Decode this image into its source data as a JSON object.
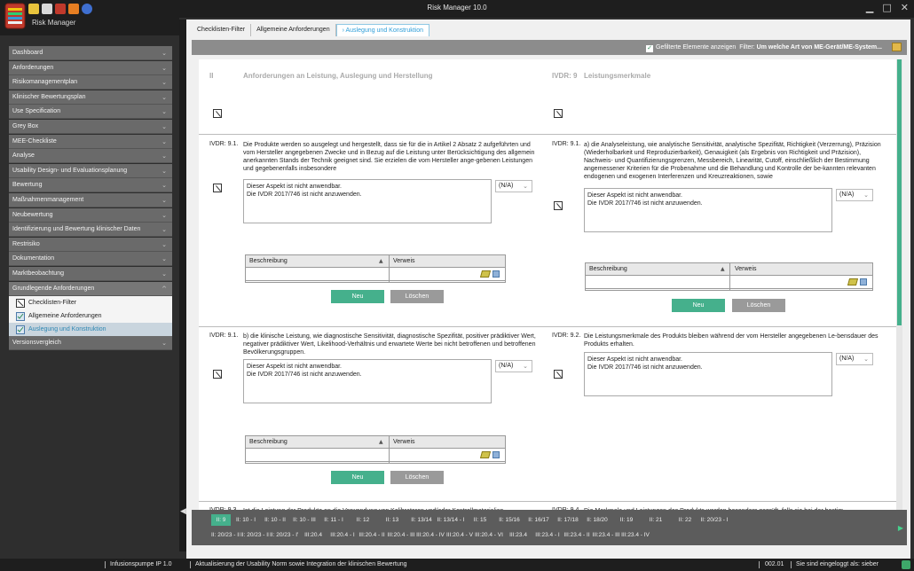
{
  "window": {
    "title": "Risk Manager 10.0",
    "minimize": "▁",
    "maximize": "□",
    "close": "✕"
  },
  "logo": {
    "label": "Risk Manager"
  },
  "sidebar": {
    "items": [
      {
        "label": "Dashboard"
      },
      {
        "label": "Anforderungen"
      },
      {
        "label": "Risikomanagementplan"
      },
      {
        "label": "Klinischer Bewertungsplan"
      },
      {
        "label": "Use Specification"
      },
      {
        "label": "Grey Box"
      },
      {
        "label": "MEE-Checkliste"
      },
      {
        "label": "Analyse"
      },
      {
        "label": "Usability Design- und Evaluationsplanung"
      },
      {
        "label": "Bewertung"
      },
      {
        "label": "Maßnahmenmanagement"
      },
      {
        "label": "Neubewertung"
      },
      {
        "label": "Identifizierung und Bewertung klinischer Daten"
      },
      {
        "label": "Restrisiko"
      },
      {
        "label": "Dokumentation"
      },
      {
        "label": "Marktbeobachtung"
      },
      {
        "label": "Grundlegende Anforderungen"
      }
    ],
    "sub_items": [
      {
        "label": "Checklisten-Filter"
      },
      {
        "label": "Allgemeine Anforderungen"
      },
      {
        "label": "Auslegung und Konstruktion"
      }
    ],
    "last_item": {
      "label": "Versionsvergleich"
    },
    "chevron_down": "⌄",
    "chevron_up": "^"
  },
  "tabs": [
    {
      "label": "Checklisten-Filter"
    },
    {
      "label": "Allgemeine Anforderungen"
    },
    {
      "label": "Auslegung und Konstruktion"
    }
  ],
  "active_tab_prefix": "›",
  "filter": {
    "checkbox_label": "Gefilterte Elemente anzeigen",
    "filter_label": "Filter:",
    "filter_value": "Um welche Art von ME-Gerät/ME-System..."
  },
  "headers": {
    "left_num": "II",
    "left_title": "Anforderungen an Leistung, Auslegung und Herstellung",
    "right_num": "IVDR: 9",
    "right_title": "Leistungsmerkmale"
  },
  "requirements": {
    "r1": {
      "num": "IVDR: 9.1.",
      "text": "Die Produkte werden so ausgelegt und hergestellt, dass sie für die in Artikel 2 Absatz 2 aufgeführten und vom Hersteller angegebenen Zwecke und in Bezug auf die Leistung unter Berücksichtigung des allgemein anerkannten Stands der Technik geeignet sind. Sie erzielen die vom Hersteller ange-gebenen Leistungen und gegebenenfalls insbesondere"
    },
    "r2": {
      "num": "IVDR: 9.1.",
      "text": "a) die Analyseleistung, wie analytische Sensitivität, analytische Spezifität, Richtigkeit (Verzerrung), Präzision (Wiederholbarkeit und Reproduzierbarkeit), Genauigkeit (als Ergebnis von Richtigkeit und Präzision), Nachweis- und Quantifizierungsgrenzen, Messbereich, Linearität, Cutoff, einschließlich der Bestimmung angemessener Kriterien für die Probenahme und die Behandlung und Kontrolle der be-kannten relevanten endogenen und exogenen Interferenzen und Kreuzreaktionen, sowie"
    },
    "r3": {
      "num": "IVDR: 9.1.",
      "text": "b) die klinische Leistung, wie diagnostische Sensitivität, diagnostische Spezifität, positiver prädiktiver Wert, negativer prädiktiver Wert, Likelihood-Verhältnis und erwartete Werte bei nicht betroffenen und betroffenen Bevölkerungsgruppen."
    },
    "r4": {
      "num": "IVDR: 9.2.",
      "text": "Die Leistungsmerkmale des Produkts bleiben während der vom Hersteller angegebenen Le-bensdauer des Produkts erhalten."
    },
    "r5": {
      "num": "IVDR: 9.3.",
      "text": "Ist die Leistung der Produkte an die Verwendung von Kalibratoren und/oder Kontrollmaterialien"
    },
    "r6": {
      "num": "IVDR: 9.4.",
      "text": "Die Merkmale und Leistungen des Produkts werden besonders geprüft, falls sie bei der bestim-"
    }
  },
  "answer": {
    "line1": "Dieser Aspekt ist nicht anwendbar.",
    "line2": "Die IVDR 2017/746 ist nicht anzuwenden.",
    "select": "(N/A)",
    "dropdown_icon": "⌄"
  },
  "grid": {
    "col1": "Beschreibung",
    "col2": "Verweis",
    "sort_icon": "▲"
  },
  "buttons": {
    "new": "Neu",
    "delete": "Löschen"
  },
  "strip": {
    "row1": [
      "II: 9",
      "II: 10 - I",
      "II: 10 - II",
      "II: 10 - III",
      "II: 11 - I",
      "II: 12",
      "II: 13",
      "II: 13/14",
      "II: 13/14 - I",
      "II: 15",
      "II: 15/16",
      "II: 16/17",
      "II: 17/18",
      "II: 18/20",
      "II: 19",
      "II: 21",
      "II: 22",
      "II: 20/23 - I"
    ],
    "row2": [
      "II: 20/23 - II",
      "II: 20/23 - III",
      "II: 20/23 - IV",
      "III:20.4",
      "III:20.4 - I",
      "III:20.4 - II",
      "III:20.4 - III",
      "III:20.4 - IV",
      "III:20.4 - V",
      "III:20.4 - VI",
      "III:23.4",
      "III:23.4 - I",
      "III:23.4 - II",
      "III:23.4 - III",
      "III:23.4 - IV"
    ],
    "arrow": "▶",
    "left_arrow": "◀"
  },
  "status": {
    "project": "Infusionspumpe IP 1.0",
    "description": "Aktualisierung der Usability Norm sowie Integration der klinischen Bewertung",
    "code": "002.01",
    "user": "Sie sind eingeloggt als: sieber"
  },
  "colors": {
    "accent": "#45b08c",
    "tab_active": "#2f9ed8",
    "sidebar_item": "#6a6a6a"
  }
}
